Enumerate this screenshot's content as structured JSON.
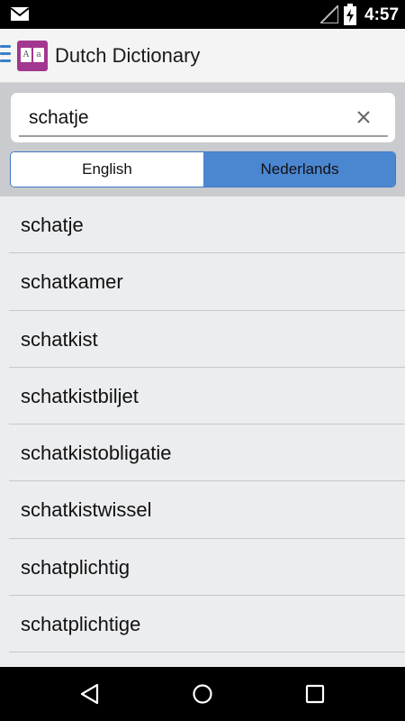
{
  "status_bar": {
    "time": "4:57"
  },
  "app_bar": {
    "title": "Dutch Dictionary",
    "logo": {
      "letter_1": "A",
      "letter_2": "a"
    }
  },
  "search": {
    "value": "schatje"
  },
  "language_tabs": [
    {
      "label": "English",
      "selected": false
    },
    {
      "label": "Nederlands",
      "selected": true
    }
  ],
  "results": [
    {
      "word": "schatje"
    },
    {
      "word": "schatkamer"
    },
    {
      "word": "schatkist"
    },
    {
      "word": "schatkistbiljet"
    },
    {
      "word": "schatkistobligatie"
    },
    {
      "word": "schatkistwissel"
    },
    {
      "word": "schatplichtig"
    },
    {
      "word": "schatplichtige"
    }
  ],
  "icons": {
    "status": [
      "mail-icon",
      "signal-icon",
      "battery-charging-icon"
    ],
    "nav": [
      "back-icon",
      "home-icon",
      "recents-icon"
    ]
  },
  "colors": {
    "accent": "#4b86d0",
    "logo": "#a2378f",
    "menu": "#3a7fc9"
  }
}
